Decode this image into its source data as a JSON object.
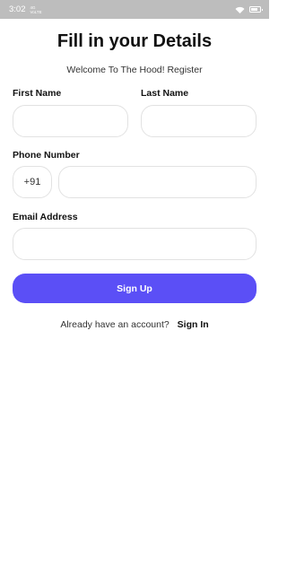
{
  "status_bar": {
    "time": "3:02",
    "network_top": "4G",
    "network_bottom": "VoLTE",
    "icons": [
      "signal-icon",
      "wifi-icon",
      "battery-icon"
    ]
  },
  "header": {
    "title": "Fill in your Details",
    "subtitle": "Welcome To The Hood! Register"
  },
  "form": {
    "first_name_label": "First Name",
    "first_name_value": "",
    "last_name_label": "Last Name",
    "last_name_value": "",
    "phone_label": "Phone Number",
    "country_code": "+91",
    "phone_value": "",
    "email_label": "Email Address",
    "email_value": ""
  },
  "actions": {
    "signup_label": "Sign Up",
    "account_prompt": "Already have an account?",
    "signin_label": "Sign In"
  },
  "colors": {
    "primary": "#5b4ff6",
    "status_bar": "#bdbdbd",
    "field_border": "#e2e2e2"
  }
}
